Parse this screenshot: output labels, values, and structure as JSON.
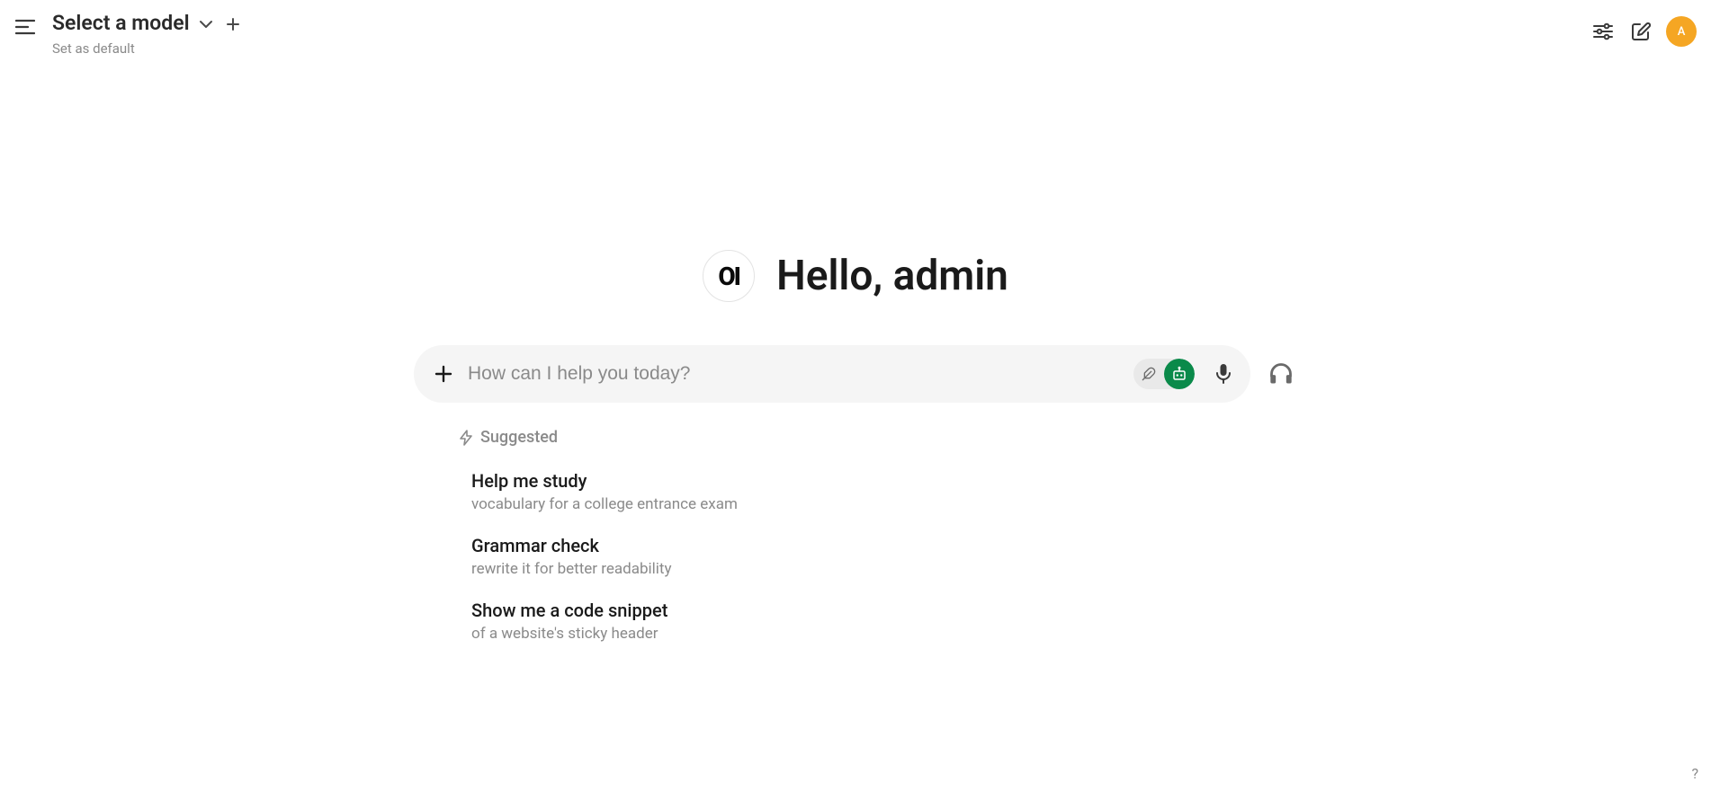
{
  "header": {
    "model_select_label": "Select a model",
    "set_default_label": "Set as default",
    "avatar_initial": "A"
  },
  "greeting": {
    "logo_text": "OI",
    "text": "Hello, admin"
  },
  "input": {
    "placeholder": "How can I help you today?"
  },
  "suggested": {
    "header_label": "Suggested",
    "items": [
      {
        "title": "Help me study",
        "sub": "vocabulary for a college entrance exam"
      },
      {
        "title": "Grammar check",
        "sub": "rewrite it for better readability"
      },
      {
        "title": "Show me a code snippet",
        "sub": "of a website's sticky header"
      }
    ]
  },
  "help": {
    "label": "?"
  }
}
